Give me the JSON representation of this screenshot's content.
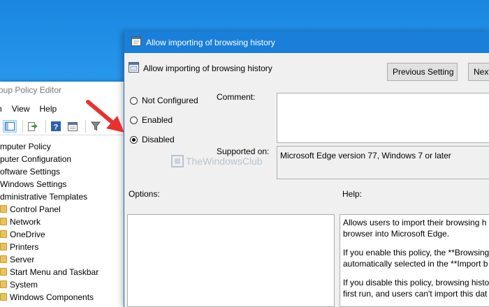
{
  "gpe": {
    "title": "oup Policy Editor",
    "menu": [
      "n",
      "View",
      "Help"
    ],
    "tree": [
      {
        "label": "mputer Policy",
        "folder": false
      },
      {
        "label": "puter Configuration",
        "folder": false
      },
      {
        "label": "oftware Settings",
        "folder": false
      },
      {
        "label": "Windows Settings",
        "folder": false
      },
      {
        "label": "dministrative Templates",
        "folder": false
      },
      {
        "label": "Control Panel",
        "folder": true
      },
      {
        "label": "Network",
        "folder": true
      },
      {
        "label": "OneDrive",
        "folder": true
      },
      {
        "label": "Printers",
        "folder": true
      },
      {
        "label": "Server",
        "folder": true
      },
      {
        "label": "Start Menu and Taskbar",
        "folder": true
      },
      {
        "label": "System",
        "folder": true
      },
      {
        "label": "Windows Components",
        "folder": true
      }
    ]
  },
  "dialog": {
    "title": "Allow importing of browsing history",
    "header": "Allow importing of browsing history",
    "prev_button": "Previous Setting",
    "next_button": "Next",
    "radios": [
      {
        "label": "Not Configured",
        "checked": false
      },
      {
        "label": "Enabled",
        "checked": false
      },
      {
        "label": "Disabled",
        "checked": true
      }
    ],
    "comment_label": "Comment:",
    "supported_label": "Supported on:",
    "supported_value": "Microsoft Edge version 77, Windows 7 or later",
    "options_label": "Options:",
    "help_label": "Help:",
    "help_lines": [
      [
        "Allows users to import their browsing h",
        "browser into Microsoft Edge."
      ],
      [
        "If you enable this policy, the **Browsing",
        "automatically selected in the **Import b"
      ],
      [
        "If you disable this policy, browsing histo",
        "first run, and users can't import this dat"
      ]
    ]
  },
  "watermark": "TheWindowsClub",
  "colors": {
    "titlebar": "#1a7fd8",
    "desktop": "#1a86e0",
    "arrow": "#e8312f"
  }
}
